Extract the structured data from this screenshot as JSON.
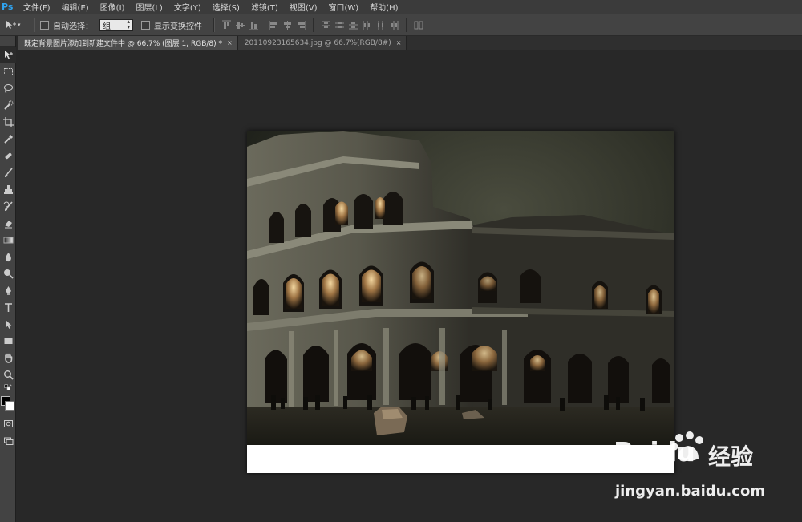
{
  "app": {
    "logo": "Ps"
  },
  "menubar": {
    "items": [
      "文件(F)",
      "编辑(E)",
      "图像(I)",
      "图层(L)",
      "文字(Y)",
      "选择(S)",
      "滤镜(T)",
      "视图(V)",
      "窗口(W)",
      "帮助(H)"
    ]
  },
  "options": {
    "auto_select_label": "自动选择：",
    "auto_select_value": "组",
    "show_transform_label": "显示变换控件"
  },
  "tabs": [
    {
      "label": "既定背景图片添加到新建文件中 @ 66.7% (图层 1, RGB/8) *",
      "close": "×"
    },
    {
      "label": "20110923165634.jpg @ 66.7%(RGB/8#)",
      "close": "×"
    }
  ],
  "tools": [
    "move-icon",
    "marquee-icon",
    "lasso-icon",
    "quick-select-icon",
    "crop-icon",
    "eyedropper-icon",
    "healing-brush-icon",
    "brush-icon",
    "clone-stamp-icon",
    "history-brush-icon",
    "eraser-icon",
    "gradient-icon",
    "blur-icon",
    "dodge-icon",
    "pen-icon",
    "type-icon",
    "path-select-icon",
    "rectangle-icon",
    "hand-icon",
    "zoom-icon"
  ],
  "colors": {
    "foreground": "#000000",
    "background": "#ffffff",
    "accent": "#2fa3f0"
  },
  "watermark": {
    "brand": "Baidu",
    "suffix": "经验",
    "url": "jingyan.baidu.com"
  }
}
